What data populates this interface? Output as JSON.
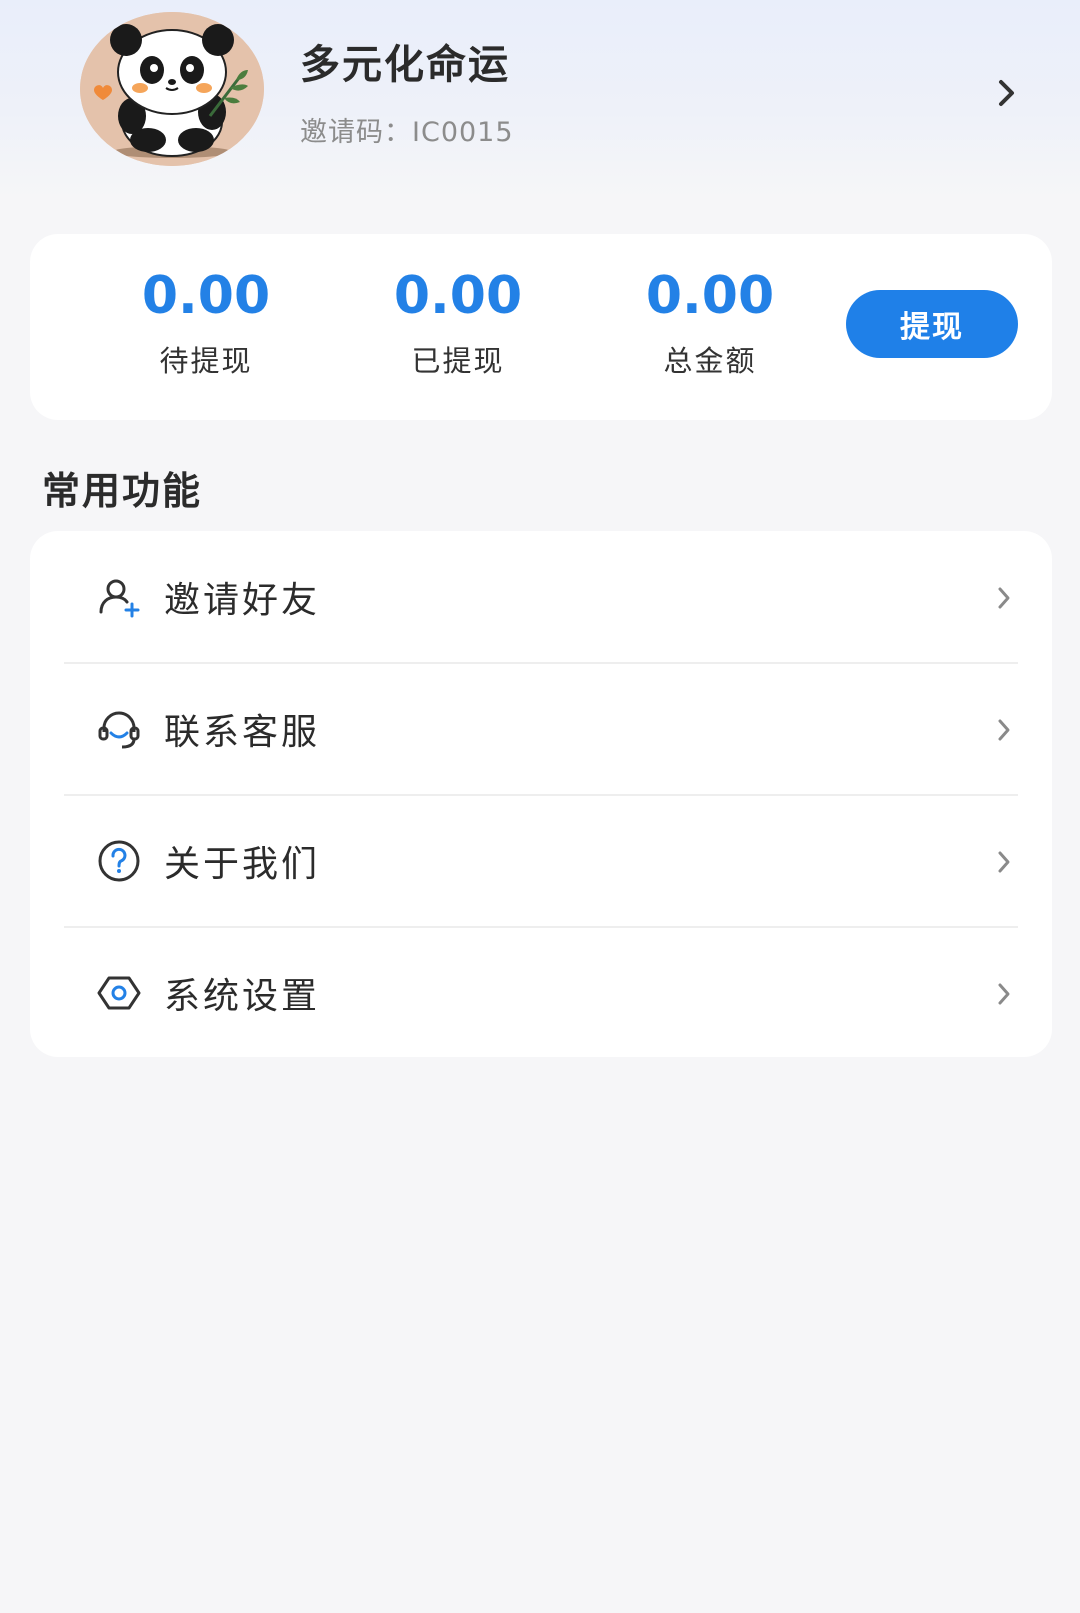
{
  "profile": {
    "name": "多元化命运",
    "invite_label": "邀请码：",
    "invite_code": "IC0015"
  },
  "balance": {
    "stats": [
      {
        "value": "0.00",
        "label": "待提现"
      },
      {
        "value": "0.00",
        "label": "已提现"
      },
      {
        "value": "0.00",
        "label": "总金额"
      }
    ],
    "withdraw_label": "提现"
  },
  "section": {
    "title": "常用功能"
  },
  "menu": {
    "items": [
      {
        "label": "邀请好友",
        "icon": "add-user-icon"
      },
      {
        "label": "联系客服",
        "icon": "headset-icon"
      },
      {
        "label": "关于我们",
        "icon": "question-circle-icon"
      },
      {
        "label": "系统设置",
        "icon": "settings-icon"
      }
    ]
  },
  "colors": {
    "accent": "#2381e6",
    "button": "#1f80e8",
    "background": "#f6f6f8",
    "card": "#ffffff"
  }
}
